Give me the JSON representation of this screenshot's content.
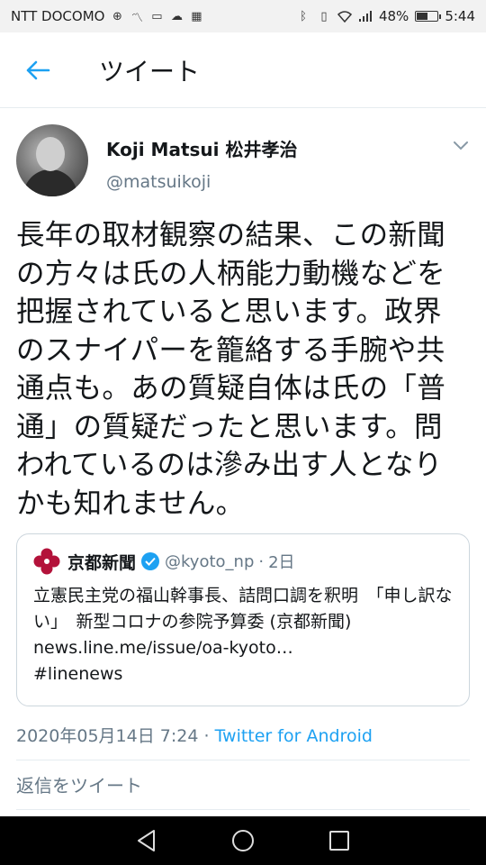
{
  "status_bar": {
    "carrier": "NTT DOCOMO",
    "battery": "48%",
    "battery_fraction": 0.48,
    "time": "5:44"
  },
  "header": {
    "title": "ツイート"
  },
  "tweet": {
    "display_name": "Koji Matsui 松井孝治",
    "handle": "@matsuikoji",
    "text": "長年の取材観察の結果、この新聞の方々は氏の人柄能力動機などを把握されていると思います。政界のスナイパーを籠絡する手腕や共通点も。あの質疑自体は氏の「普通」の質疑だったと思います。問われているのは滲み出す人となりかも知れません。",
    "date": "2020年05月14日 7:24",
    "separator": "·",
    "source": "Twitter for Android"
  },
  "quote": {
    "name": "京都新聞",
    "handle": "@kyoto_np",
    "separator": "·",
    "time": "2日",
    "body": "立憲民主党の福山幹事長、詰問口調を釈明　「申し訳ない」　新型コロナの参院予算委 (京都新聞) news.line.me/issue/oa-kyoto…\n#linenews"
  },
  "reply": {
    "placeholder": "返信をツイート"
  },
  "colors": {
    "accent": "#1da1f2",
    "secondary_text": "#657786",
    "logo_red": "#b3123a"
  }
}
